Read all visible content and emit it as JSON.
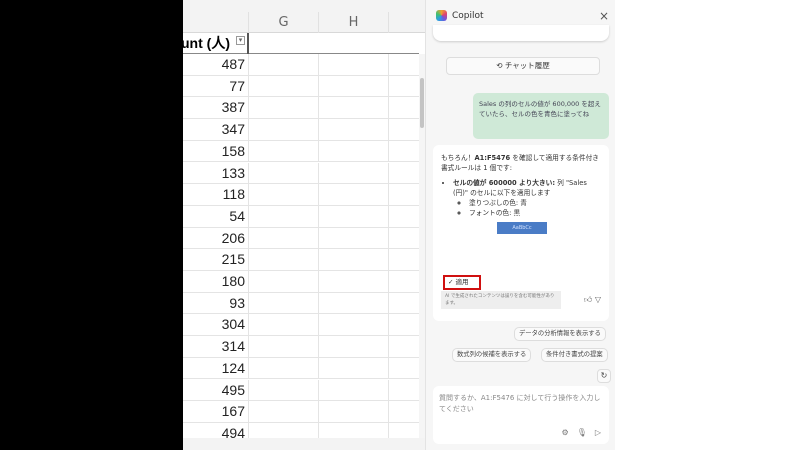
{
  "sheet": {
    "columns": [
      "G",
      "H"
    ],
    "header": "unt (人)",
    "filter_icon": "filter-dropdown-icon",
    "values": [
      "487",
      "77",
      "387",
      "347",
      "158",
      "133",
      "118",
      "54",
      "206",
      "215",
      "180",
      "93",
      "304",
      "314",
      "124",
      "495",
      "167",
      "494"
    ]
  },
  "copilot": {
    "title": "Copilot",
    "close": "×",
    "history_button": "チャット履歴",
    "user_message": "Sales の列のセルの値が 600,000 を超えていたら、セルの色を青色に塗ってね",
    "reply": {
      "intro_a": "もちろん！",
      "range": "A1:F5476",
      "intro_b": " を確認して適用する条件付き書式ルールは 1 個です:",
      "rule_bold": "セルの値が 600000 より大きい:",
      "rule_text": " 列 \"Sales (円)\" のセルに以下を適用します",
      "fill": "塗りつぶしの色: 青",
      "font": "フォントの色: 黒",
      "preview": "AaBbCc",
      "apply": "✓ 適用",
      "disclaimer": "AI で生成されたコンテンツは誤りを含む可能性があります。"
    },
    "suggestions": [
      "データの分析情報を表示する",
      "数式列の候補を表示する",
      "条件付き書式の提案"
    ],
    "input_placeholder": "質問するか、A1:F5476 に対して行う操作を入力してください"
  }
}
